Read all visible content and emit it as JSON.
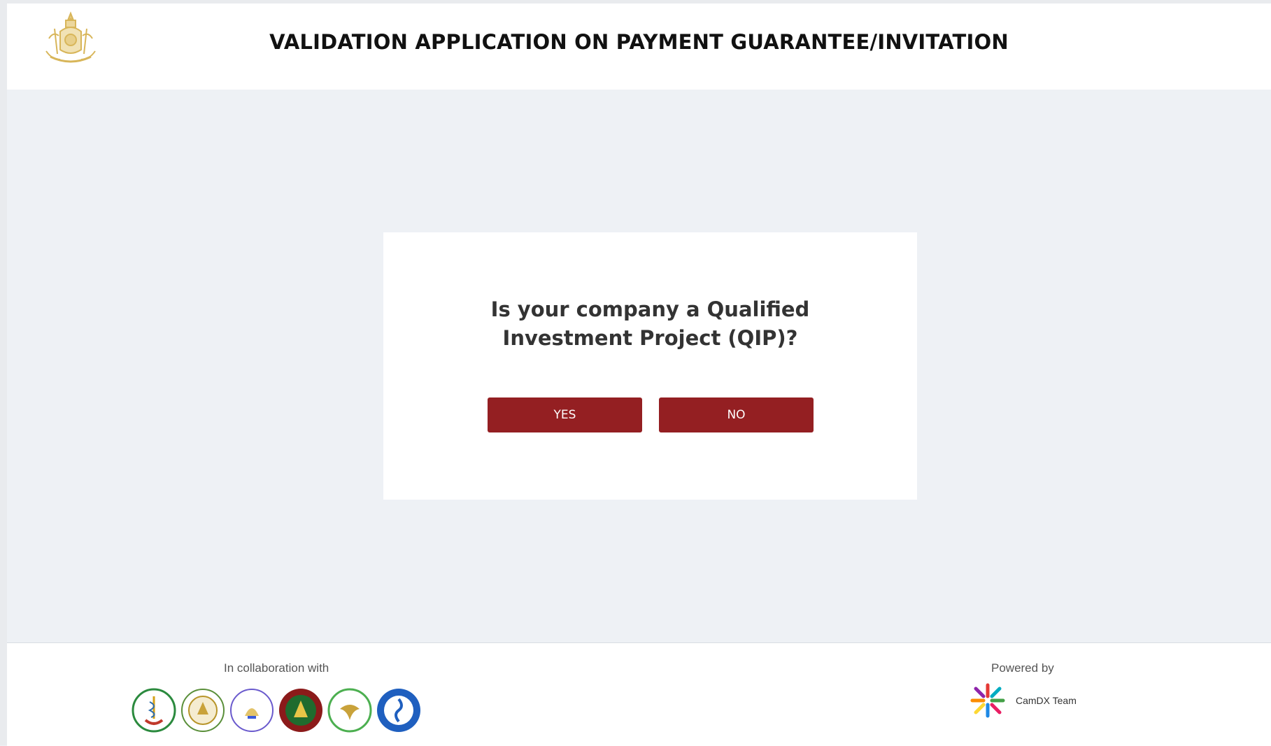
{
  "header": {
    "title": "VALIDATION APPLICATION ON PAYMENT GUARANTEE/INVITATION",
    "emblem_icon": "royal-emblem-icon"
  },
  "dialog": {
    "question": "Is your company a Qualified Investment Project (QIP)?",
    "yes_label": "YES",
    "no_label": "NO"
  },
  "footer": {
    "collab_label": "In collaboration with",
    "partner_logos": [
      "ministry-health-logo",
      "ministry-seal-logo",
      "ministry-emblem-logo",
      "green-seal-logo",
      "bird-seal-logo",
      "blue-seal-logo"
    ],
    "powered_label": "Powered by",
    "powered_name": "CamDX Team"
  },
  "colors": {
    "button": "#941f22",
    "background": "#eef1f5",
    "emblem_gold": "#d8b65a"
  }
}
